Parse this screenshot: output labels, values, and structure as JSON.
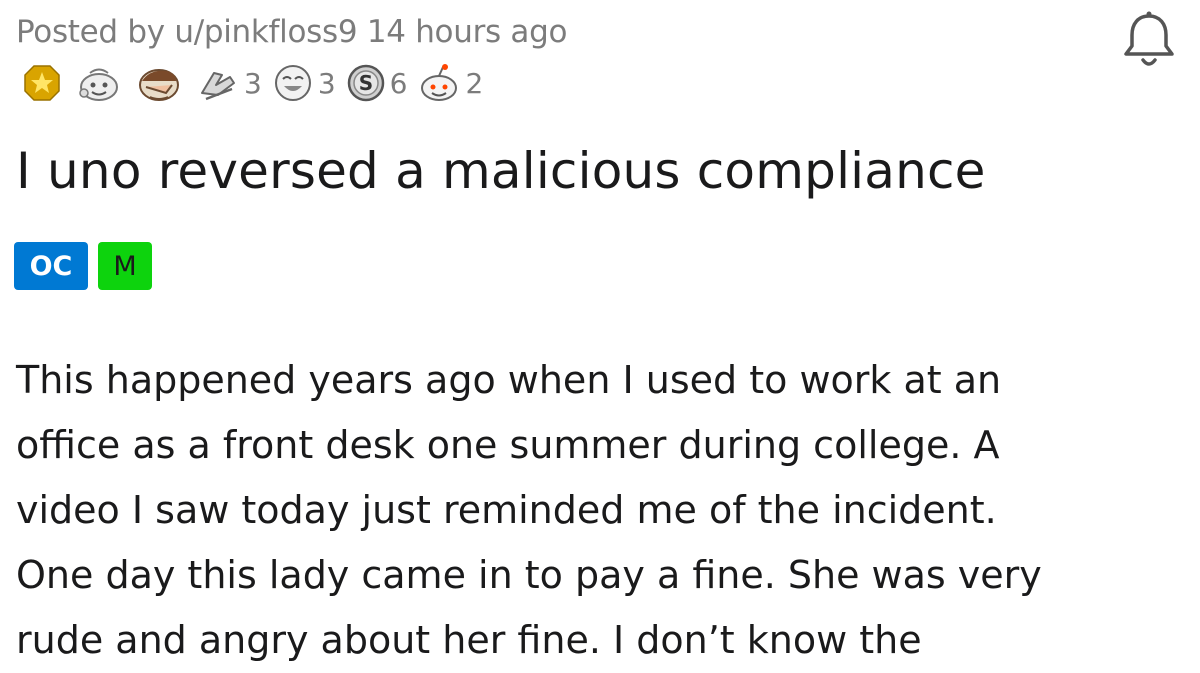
{
  "post": {
    "posted_by_prefix": "Posted by ",
    "username": "u/pinkfloss9",
    "time_ago": "14 hours ago",
    "title": "I uno reversed a malicious compliance",
    "flairs": [
      "OC",
      "M"
    ],
    "flair_colors": {
      "OC": "#0079d3",
      "M": "#0dd30d"
    },
    "body_lines": [
      "This happened years ago when I used to work at an",
      "office as a front desk one summer during college. A",
      "video I saw today just reminded me of the incident.",
      "One day this lady came in to pay a fine. She was very",
      "rude and angry about her fine. I don’t know the"
    ]
  },
  "awards": [
    {
      "icon": "gold-star-award-icon",
      "count": ""
    },
    {
      "icon": "wholesome-award-icon",
      "count": ""
    },
    {
      "icon": "facepalm-award-icon",
      "count": ""
    },
    {
      "icon": "hands-award-icon",
      "count": "3"
    },
    {
      "icon": "laughing-award-icon",
      "count": "3"
    },
    {
      "icon": "silver-coin-award-icon",
      "count": "6"
    },
    {
      "icon": "snoo-award-icon",
      "count": "2"
    }
  ],
  "actions": {
    "bell_icon": "bell-icon"
  }
}
